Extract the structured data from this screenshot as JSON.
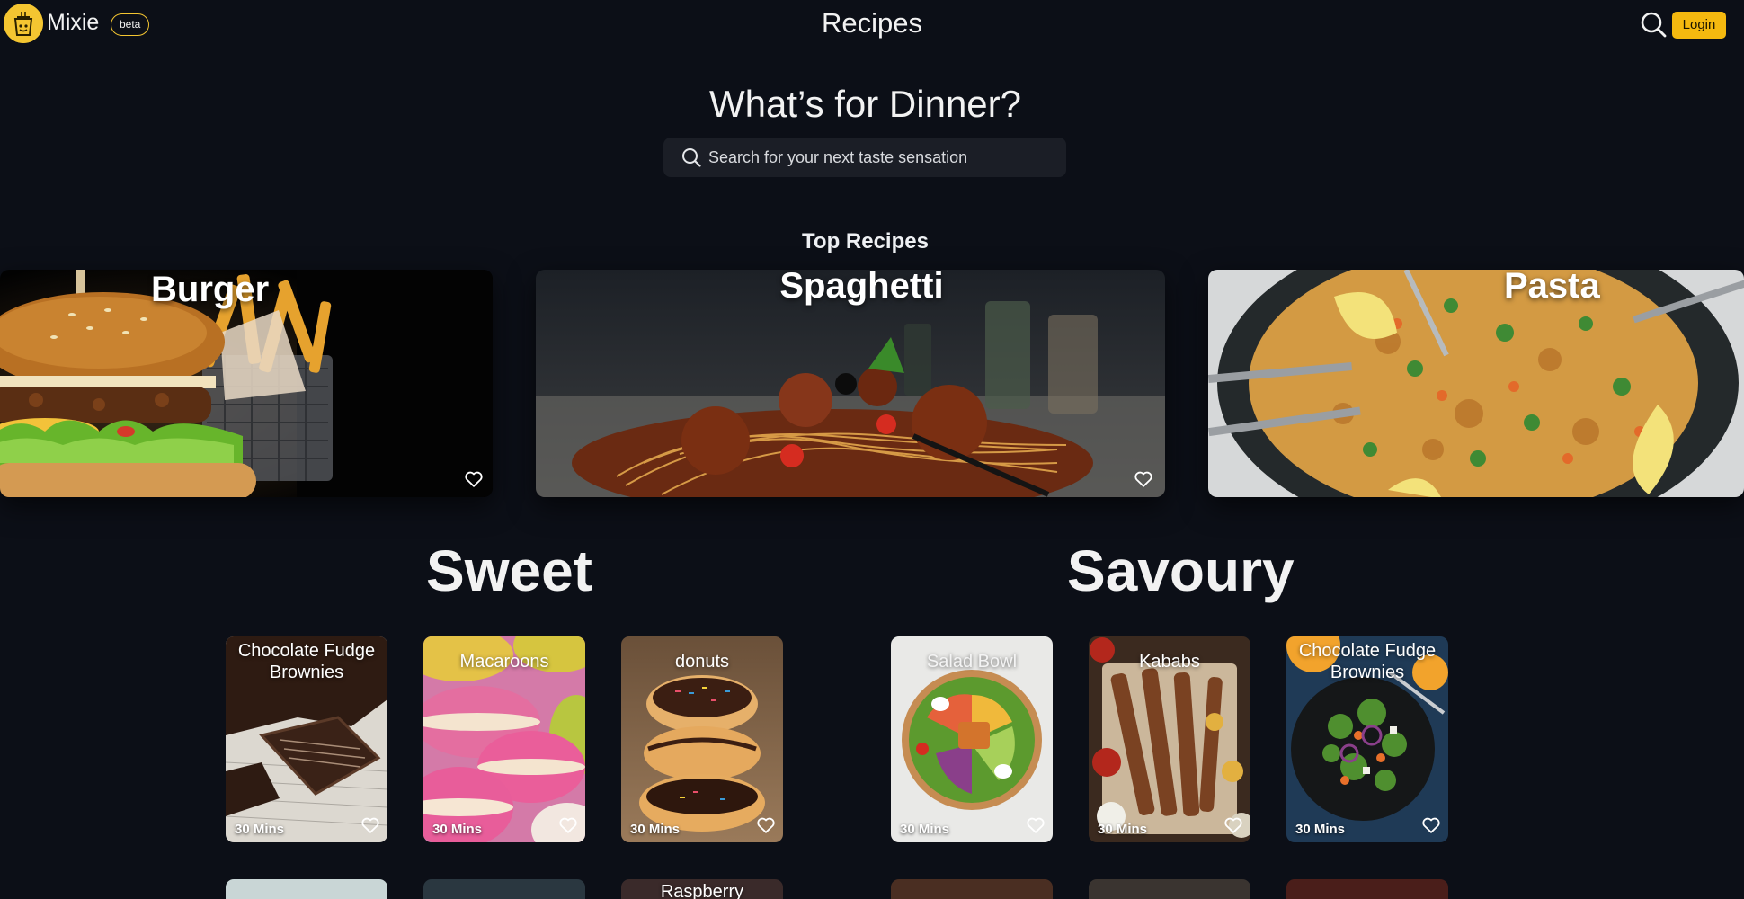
{
  "header": {
    "brand": "Mixie",
    "badge": "beta",
    "title": "Recipes",
    "login_label": "Login"
  },
  "hero": {
    "heading": "What’s for Dinner?",
    "search_placeholder": "Search for your next taste sensation"
  },
  "top_recipes": {
    "heading": "Top Recipes",
    "items": [
      {
        "title": "Burger"
      },
      {
        "title": "Spaghetti"
      },
      {
        "title": "Pasta"
      }
    ]
  },
  "sweet": {
    "heading": "Sweet",
    "items": [
      {
        "title": "Chocolate Fudge Brownies",
        "time": "30 Mins"
      },
      {
        "title": "Macaroons",
        "time": "30 Mins"
      },
      {
        "title": "donuts",
        "time": "30 Mins"
      }
    ],
    "row2": [
      {
        "title": ""
      },
      {
        "title": ""
      },
      {
        "title": "Raspberry"
      }
    ]
  },
  "savoury": {
    "heading": "Savoury",
    "items": [
      {
        "title": "Salad Bowl",
        "time": "30 Mins"
      },
      {
        "title": "Kababs",
        "time": "30 Mins"
      },
      {
        "title": "Chocolate Fudge Brownies",
        "time": "30 Mins"
      }
    ],
    "row2": [
      {
        "title": ""
      },
      {
        "title": ""
      },
      {
        "title": ""
      }
    ]
  },
  "colors": {
    "background": "#0c0f17",
    "accent": "#f5b90f",
    "search_bg": "#1b1e26"
  },
  "icons": [
    "logo-icon",
    "search-icon",
    "heart-icon"
  ]
}
